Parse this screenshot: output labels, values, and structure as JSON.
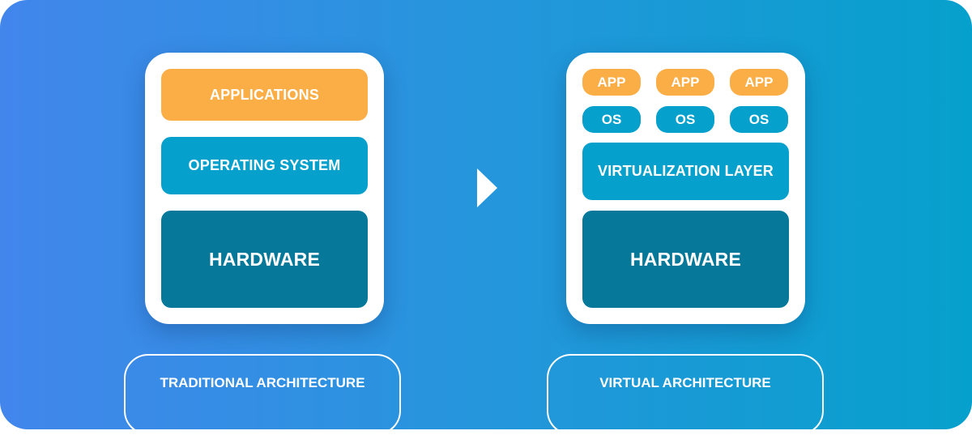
{
  "traditional": {
    "title": "TRADITIONAL ARCHITECTURE",
    "layers": [
      "APPLICATIONS",
      "OPERATING SYSTEM",
      "HARDWARE"
    ]
  },
  "virtual": {
    "title": "VIRTUAL ARCHITECTURE",
    "apps": [
      "APP",
      "APP",
      "APP"
    ],
    "oses": [
      "OS",
      "OS",
      "OS"
    ],
    "virtualization": "VIRTUALIZATION LAYER",
    "hardware": "HARDWARE"
  },
  "arrow_icon": "triangle-right-icon",
  "colors": {
    "app": "#fbae46",
    "os": "#06a0cc",
    "hardware": "#06789a",
    "bg_start": "#4286ec",
    "bg_end": "#06a0cc"
  }
}
